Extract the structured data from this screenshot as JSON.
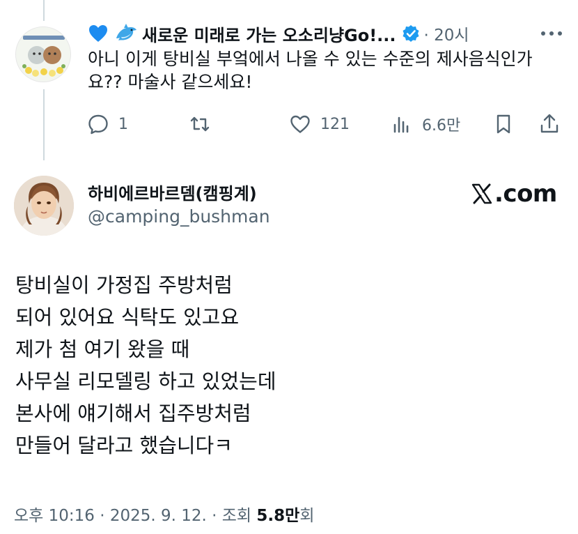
{
  "reply": {
    "display_name": "새로운 미래로 가는 오소리냥Go!...",
    "time": "· 20시",
    "text": "아니 이게 탕비실 부엌에서 나올 수 있는 수준의 제사음식인가요?? 마술사 같으세요!",
    "actions": {
      "reply_count": "1",
      "retweet_count": "",
      "like_count": "121",
      "view_count": "6.6만"
    },
    "avatar_caption": "새로운 미래로 가는 오소리냥"
  },
  "tweet": {
    "display_name": "하비에르바르뎀(캠핑계)",
    "handle": "@camping_bushman",
    "brand": ".com",
    "lines": [
      "탕비실이 가정집 주방처럼",
      "되어 있어요 식탁도 있고요",
      "제가 첨 여기 왔을 때",
      "사무실 리모델링 하고 있었는데",
      "본사에 얘기해서 집주방처럼",
      "만들어 달라고 했습니다ㅋ"
    ],
    "footer": {
      "time": "오후 10:16 · 2025. 9. 12. · 조회 ",
      "views": "5.8만",
      "views_suffix": "회"
    }
  },
  "colors": {
    "text": "#0f1419",
    "secondary": "#536471",
    "verified": "#1d9bf0",
    "thread_line": "#cfd9de"
  }
}
